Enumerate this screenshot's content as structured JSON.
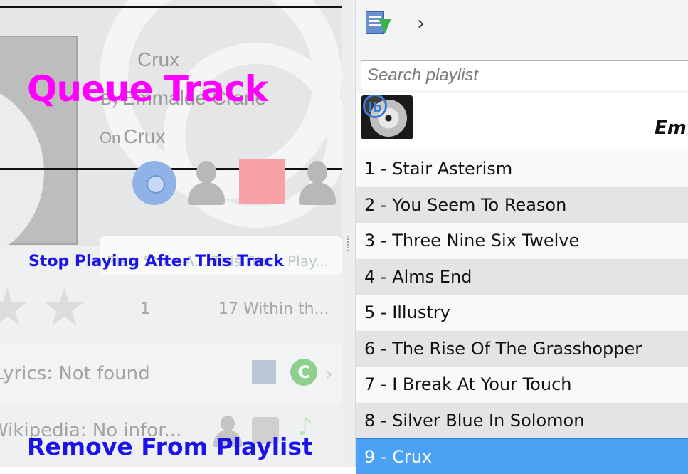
{
  "now_playing": {
    "title": "Crux",
    "artist_prefix": "By",
    "artist": "Emmalde Crane",
    "album_prefix": "On",
    "album": "Crux",
    "overlay_queue_track": "Queue Track",
    "overlay_stop_after": "Stop Playing After This Track",
    "stop_bar_ghost": "Play. Sto... A... This Track Play...",
    "play_count": "1",
    "skip_count": "17",
    "last_played": "Within th...",
    "rating_stars": 0
  },
  "lyrics": {
    "text": "Lyrics: Not found"
  },
  "wikipedia": {
    "text": "Wikipedia: No infor...",
    "overlay_remove": "Remove From Playlist"
  },
  "toolbar": {
    "chevron": "›"
  },
  "search": {
    "placeholder": "Search playlist"
  },
  "album_group": {
    "artist": "Em",
    "badge": "lb"
  },
  "tracks": [
    {
      "label": "1 - Stair Asterism"
    },
    {
      "label": "2 - You Seem To Reason"
    },
    {
      "label": "3 - Three Nine Six Twelve"
    },
    {
      "label": "4 - Alms End"
    },
    {
      "label": "5 - Illustry"
    },
    {
      "label": "6 - The Rise Of The Grasshopper"
    },
    {
      "label": "7 - I Break At Your Touch"
    },
    {
      "label": "8 - Silver Blue In Solomon"
    },
    {
      "label": "9 - Crux",
      "selected": true
    }
  ],
  "colors": {
    "overlay_magenta": "#ff00ff",
    "overlay_blue": "#1a14e6",
    "selection": "#4ba2f4",
    "stop_button": "#f7a0a6"
  }
}
